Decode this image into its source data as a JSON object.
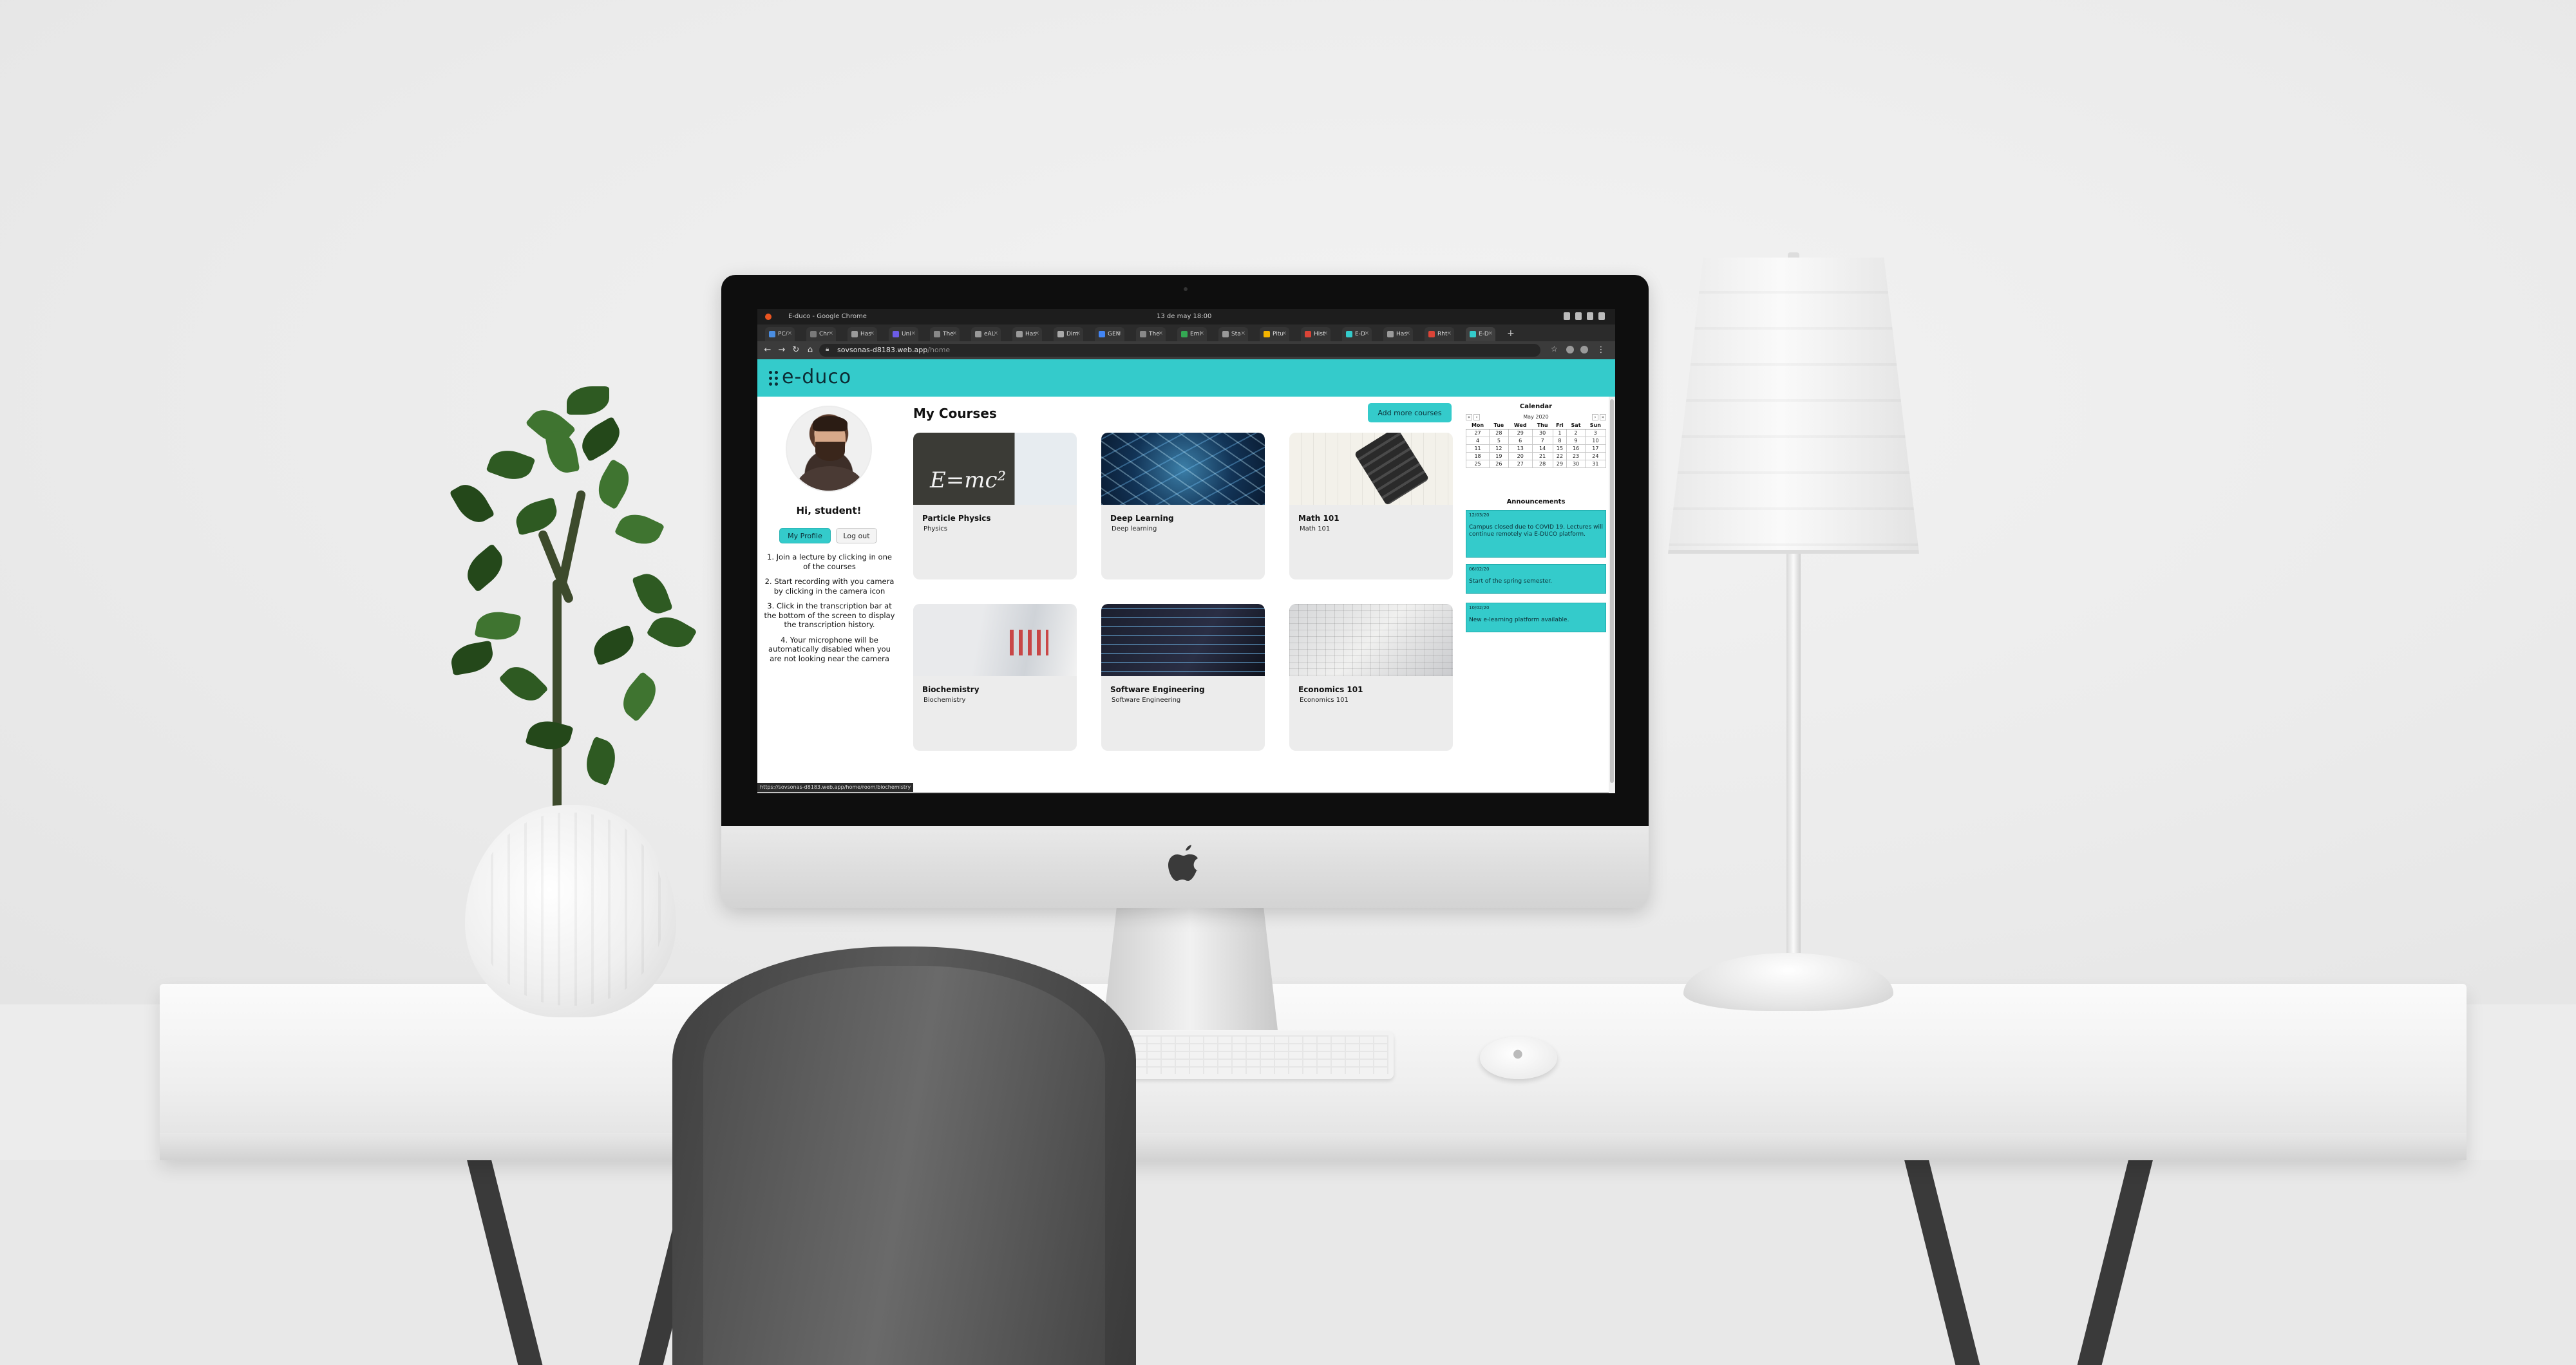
{
  "os": {
    "window_title": "E-duco - Google Chrome",
    "clock": "13 de may 18:00"
  },
  "browser": {
    "tabs": [
      {
        "label": "PC/"
      },
      {
        "label": "Chr"
      },
      {
        "label": "Has"
      },
      {
        "label": "Uni"
      },
      {
        "label": "The"
      },
      {
        "label": "eAL"
      },
      {
        "label": "Has"
      },
      {
        "label": "Dim"
      },
      {
        "label": "GEN"
      },
      {
        "label": "The"
      },
      {
        "label": "Emi"
      },
      {
        "label": "Sta"
      },
      {
        "label": "Pitu"
      },
      {
        "label": "Hist"
      },
      {
        "label": "E-D"
      },
      {
        "label": "Has"
      },
      {
        "label": "Rht"
      },
      {
        "label": "E-D"
      }
    ],
    "url_host": "sovsonas-d8183.web.app",
    "url_path": "/home",
    "status_url": "https://sovsonas-d8183.web.app/home/room/biochemistry"
  },
  "app": {
    "logo": "e-duco",
    "left": {
      "greeting": "Hi, student!",
      "profile_btn": "My Profile",
      "logout_btn": "Log out",
      "instructions": [
        "1. Join a lecture by clicking in one of the courses",
        "2. Start recording with you camera by clicking in the camera icon",
        "3. Click in the transcription bar at the bottom of the screen to display the transcription history.",
        "4. Your microphone will be automatically disabled when you are not looking near the camera"
      ]
    },
    "main": {
      "title": "My Courses",
      "add_btn": "Add more courses",
      "courses": [
        {
          "title": "Particle Physics",
          "subtitle": "Physics"
        },
        {
          "title": "Deep Learning",
          "subtitle": "Deep learning"
        },
        {
          "title": "Math 101",
          "subtitle": "Math 101"
        },
        {
          "title": "Biochemistry",
          "subtitle": "Biochemistry"
        },
        {
          "title": "Software Engineering",
          "subtitle": "Software Engineering"
        },
        {
          "title": "Economics 101",
          "subtitle": "Economics 101"
        }
      ]
    },
    "calendar": {
      "title": "Calendar",
      "month": "May 2020",
      "days": [
        "Mon",
        "Tue",
        "Wed",
        "Thu",
        "Fri",
        "Sat",
        "Sun"
      ],
      "weeks": [
        [
          "27",
          "28",
          "29",
          "30",
          "1",
          "2",
          "3"
        ],
        [
          "4",
          "5",
          "6",
          "7",
          "8",
          "9",
          "10"
        ],
        [
          "11",
          "12",
          "13",
          "14",
          "15",
          "16",
          "17"
        ],
        [
          "18",
          "19",
          "20",
          "21",
          "22",
          "23",
          "24"
        ],
        [
          "25",
          "26",
          "27",
          "28",
          "29",
          "30",
          "31"
        ]
      ]
    },
    "announcements": {
      "title": "Announcements",
      "items": [
        {
          "date": "12/03/20",
          "text": "Campus closed due to COVID 19. Lectures will continue remotely via E-DUCO platform."
        },
        {
          "date": "06/02/20",
          "text": "Start of the spring semester."
        },
        {
          "date": "10/02/20",
          "text": "New e-learning platform available."
        }
      ]
    }
  }
}
